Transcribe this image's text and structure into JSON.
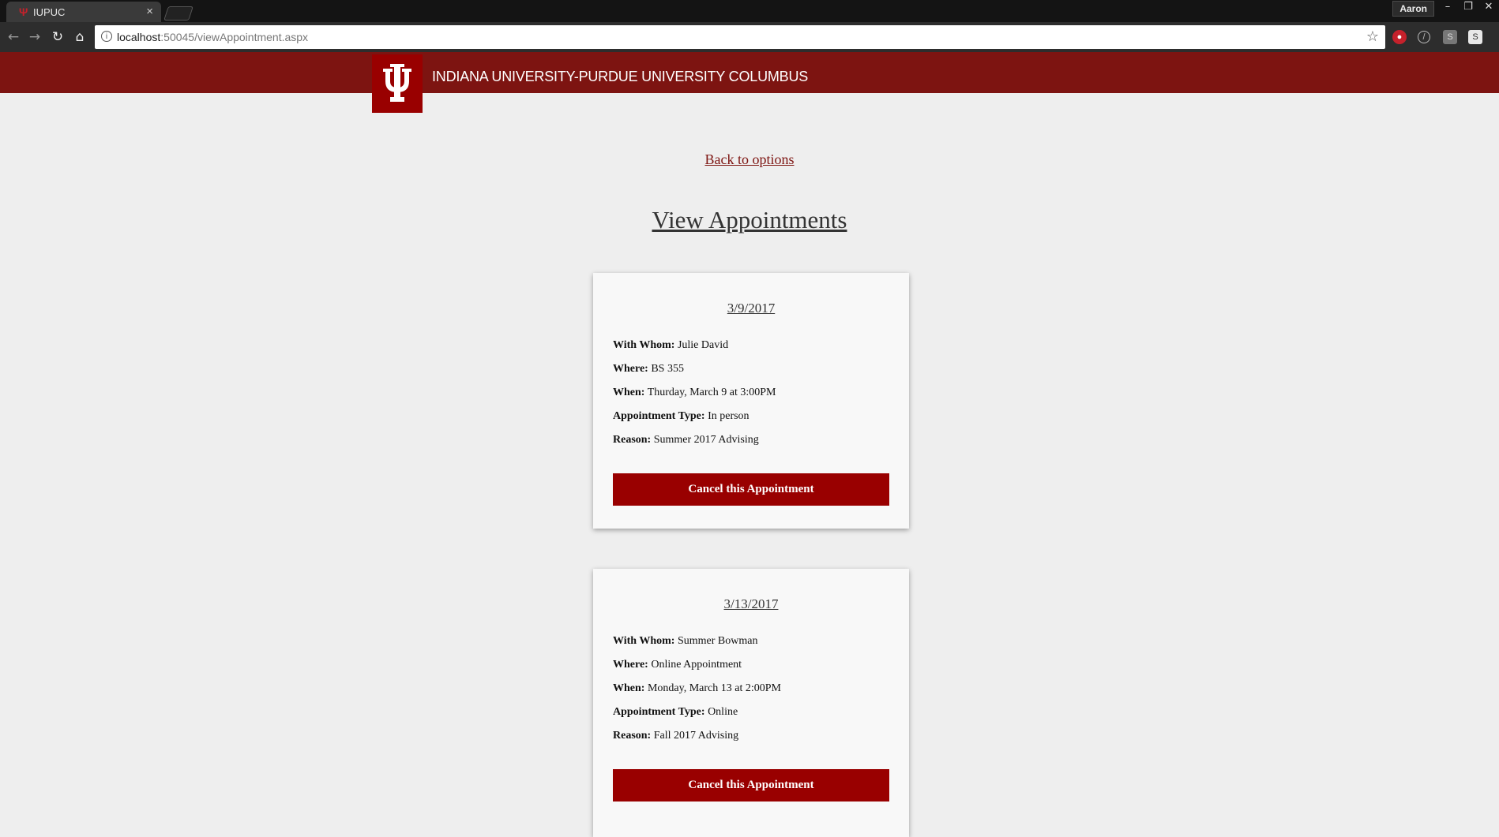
{
  "browser": {
    "tab_title": "IUPUC",
    "tab_close": "×",
    "tab_favicon": "Ψ",
    "profile_name": "Aaron",
    "url_host": "localhost",
    "url_rest": ":50045/viewAppointment.aspx"
  },
  "site": {
    "name": "INDIANA UNIVERSITY-PURDUE UNIVERSITY COLUMBUS",
    "brand_color": "#7d1411",
    "logo_color": "#990000"
  },
  "page": {
    "back_link": "Back to options",
    "title": "View Appointments"
  },
  "labels": {
    "with_whom": "With Whom:",
    "where": "Where:",
    "when": "When:",
    "type": "Appointment Type:",
    "reason": "Reason:"
  },
  "appointments": [
    {
      "date": "3/9/2017",
      "with_whom": "Julie David",
      "where": "BS 355",
      "when": "Thurday, March 9 at 3:00PM",
      "type": "In person",
      "reason": "Summer 2017 Advising",
      "cancel_label": "Cancel this Appointment"
    },
    {
      "date": "3/13/2017",
      "with_whom": "Summer Bowman",
      "where": "Online Appointment",
      "when": "Monday, March 13 at 2:00PM",
      "type": "Online",
      "reason": "Fall 2017 Advising",
      "cancel_label": "Cancel this Appointment"
    }
  ]
}
